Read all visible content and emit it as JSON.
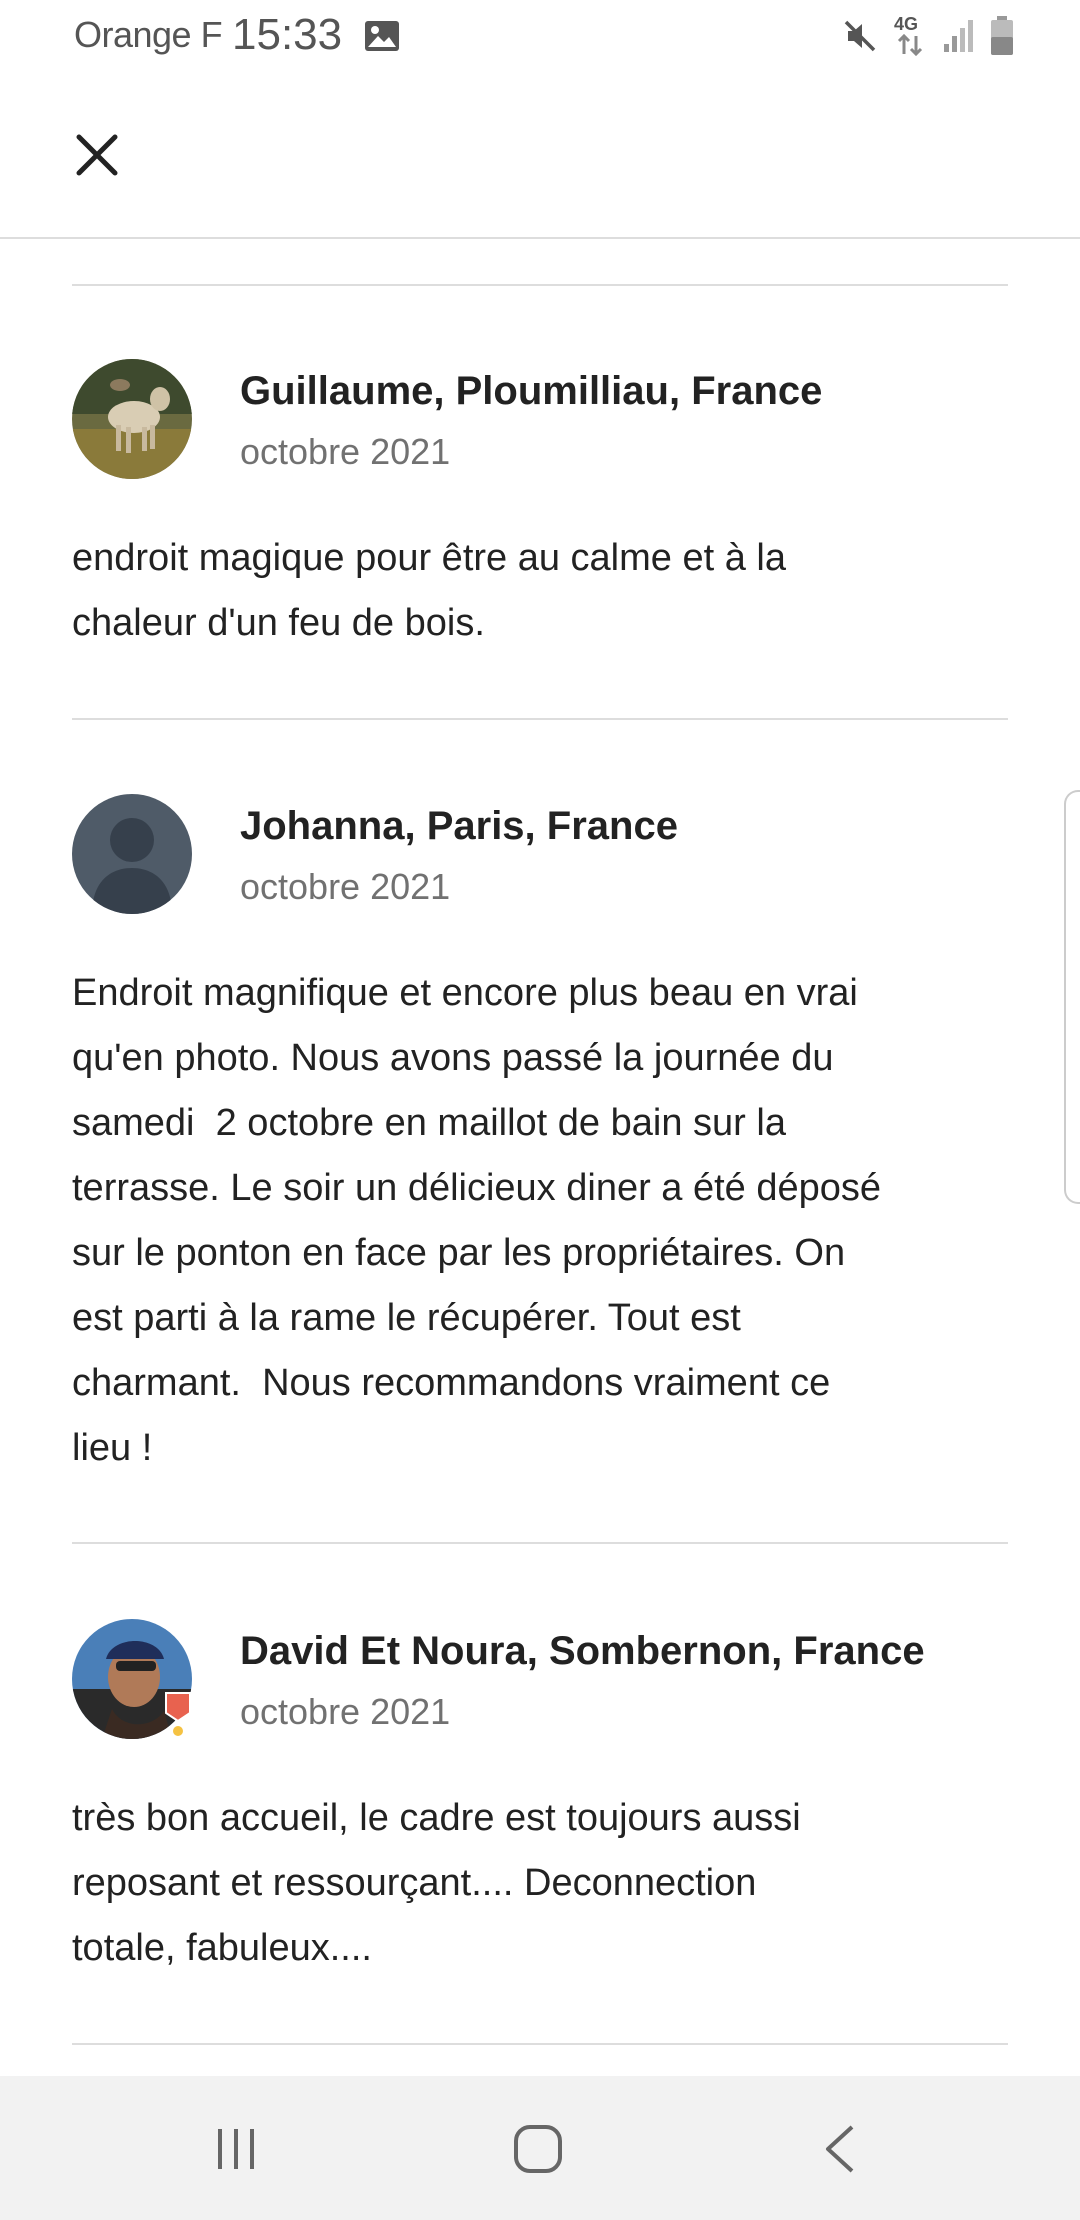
{
  "status_bar": {
    "carrier": "Orange F",
    "time": "15:33",
    "network": "4G"
  },
  "app_bar": {
    "close_icon": "close-icon"
  },
  "reviews": [
    {
      "name": "Guillaume, Ploumilliau, France",
      "date": "octobre 2021",
      "text": "endroit magique pour être au calme et à la\nchaleur d'un feu de bois."
    },
    {
      "name": "Johanna, Paris, France",
      "date": "octobre 2021",
      "text": "Endroit magnifique et encore plus beau en vrai\nqu'en photo. Nous avons passé la journée du\nsamedi  2 octobre en maillot de bain sur la\nterrasse. Le soir un délicieux diner a été déposé\nsur le ponton en face par les propriétaires. On\nest parti à la rame le récupérer. Tout est\ncharmant.  Nous recommandons vraiment ce\nlieu !"
    },
    {
      "name": "David Et Noura, Sombernon, France",
      "date": "octobre 2021",
      "text": "très bon accueil, le cadre est toujours aussi\nreposant et ressourçant.... Deconnection\ntotale, fabuleux...."
    }
  ],
  "nav_bar": {
    "icons": [
      "recent-apps-icon",
      "home-icon",
      "back-icon"
    ]
  },
  "colors": {
    "text_primary": "#222222",
    "text_secondary": "#717171",
    "divider": "#dddddd",
    "nav_background": "#f2f2f2"
  }
}
